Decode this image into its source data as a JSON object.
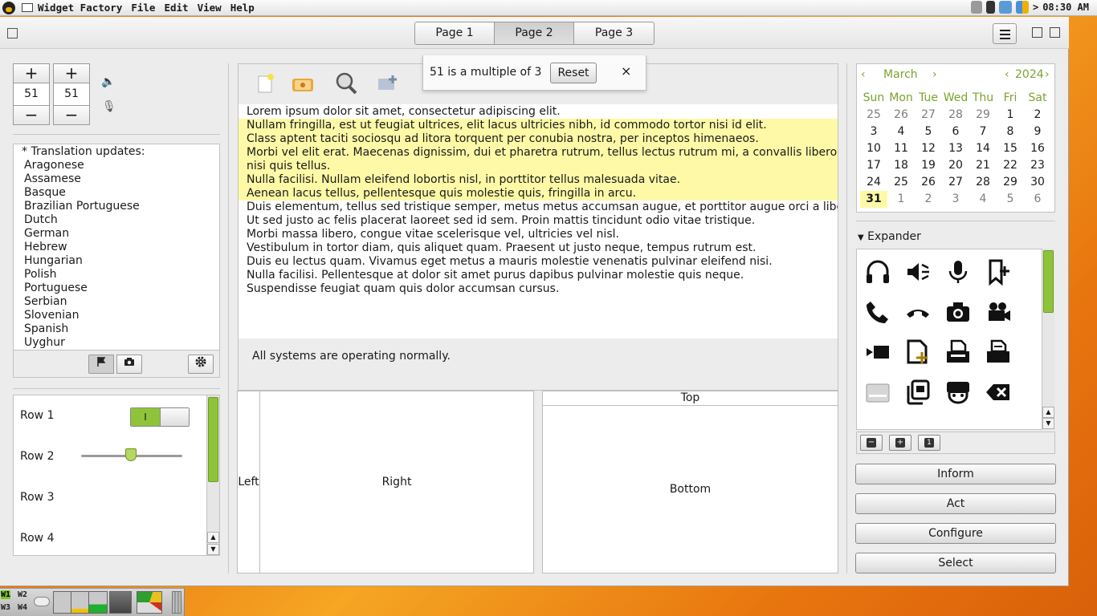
{
  "menubar": {
    "app_title": "Widget Factory",
    "menus": [
      "File",
      "Edit",
      "View",
      "Help"
    ],
    "clock": "08:30 AM",
    "tray_arrow": ">"
  },
  "tabs": [
    "Page 1",
    "Page 2",
    "Page 3"
  ],
  "active_tab": 1,
  "spinners": [
    {
      "value": "51",
      "plus": "+",
      "minus": "−"
    },
    {
      "value": "51",
      "plus": "+",
      "minus": "−"
    }
  ],
  "languages": {
    "header": "* Translation updates:",
    "items": [
      "Aragonese",
      "Assamese",
      "Basque",
      "Brazilian Portuguese",
      "Dutch",
      "German",
      "Hebrew",
      "Hungarian",
      "Polish",
      "Portuguese",
      "Serbian",
      "Slovenian",
      "Spanish",
      "Uyghur"
    ]
  },
  "rows": {
    "labels": [
      "Row 1",
      "Row 2",
      "Row 3",
      "Row 4"
    ],
    "switch_on_label": "I",
    "switch_state": true,
    "slider_value": 0.49
  },
  "notification": {
    "message": "51 is a multiple of 3",
    "reset_label": "Reset",
    "close_glyph": "×"
  },
  "editor": {
    "lines": [
      {
        "text": "Lorem ipsum dolor sit amet, consectetur adipiscing elit.",
        "hl": false
      },
      {
        "text": "Nullam fringilla, est ut feugiat ultrices, elit lacus ultricies nibh, id commodo tortor nisi id elit.",
        "hl": true
      },
      {
        "text": "Class aptent taciti sociosqu ad litora torquent per conubia nostra, per inceptos himenaeos.",
        "hl": true
      },
      {
        "text": "Morbi vel elit erat. Maecenas dignissim, dui et pharetra rutrum, tellus lectus rutrum mi, a convallis libero nisi quis tellus.",
        "hl": true
      },
      {
        "text": "Nulla facilisi. Nullam eleifend lobortis nisl, in porttitor tellus malesuada vitae.",
        "hl": true
      },
      {
        "text": "Aenean lacus tellus, pellentesque quis molestie quis, fringilla in arcu.",
        "hl": true
      },
      {
        "text": "Duis elementum, tellus sed tristique semper, metus metus accumsan augue, et porttitor augue orci a libero.",
        "hl": false
      },
      {
        "text": "Ut sed justo ac felis placerat laoreet sed id sem. Proin mattis tincidunt odio vitae tristique.",
        "hl": false
      },
      {
        "text": "Morbi massa libero, congue vitae scelerisque vel, ultricies vel nisl.",
        "hl": false
      },
      {
        "text": "Vestibulum in tortor diam, quis aliquet quam. Praesent ut justo neque, tempus rutrum est.",
        "hl": false
      },
      {
        "text": "Duis eu lectus quam. Vivamus eget metus a mauris molestie venenatis pulvinar eleifend nisi.",
        "hl": false
      },
      {
        "text": "Nulla facilisi. Pellentesque at dolor sit amet purus dapibus pulvinar molestie quis neque.",
        "hl": false
      },
      {
        "text": "Suspendisse feugiat quam quis dolor accumsan cursus.",
        "hl": false
      }
    ],
    "status": "All systems are operating normally."
  },
  "panes": {
    "left": "Left",
    "right": "Right",
    "top": "Top",
    "bottom": "Bottom"
  },
  "calendar": {
    "prev": "‹",
    "next": "›",
    "month": "March",
    "year": "2024",
    "day_names": [
      "Sun",
      "Mon",
      "Tue",
      "Wed",
      "Thu",
      "Fri",
      "Sat"
    ],
    "days": [
      [
        "25",
        "26",
        "27",
        "28",
        "29",
        "1",
        "2"
      ],
      [
        "3",
        "4",
        "5",
        "6",
        "7",
        "8",
        "9"
      ],
      [
        "10",
        "11",
        "12",
        "13",
        "14",
        "15",
        "16"
      ],
      [
        "17",
        "18",
        "19",
        "20",
        "21",
        "22",
        "23"
      ],
      [
        "24",
        "25",
        "26",
        "27",
        "28",
        "29",
        "30"
      ],
      [
        "31",
        "1",
        "2",
        "3",
        "4",
        "5",
        "6"
      ]
    ],
    "selected": "31"
  },
  "expander": {
    "label": "Expander",
    "icons": [
      "headphones-icon",
      "speaker-muted-icon",
      "microphone-icon",
      "bookmark-add-icon",
      "phone-icon",
      "hangup-icon",
      "camera-icon",
      "video-camera-icon",
      "video-record-icon",
      "document-new-icon",
      "printer-icon",
      "printer-alt-icon",
      "scanner-icon",
      "copy-icon",
      "face-icon",
      "backspace-icon"
    ],
    "tools": [
      "−",
      "+",
      "1"
    ]
  },
  "actions": [
    "Inform",
    "Act",
    "Configure",
    "Select"
  ],
  "taskbar": {
    "workspaces": [
      "W1",
      "W2",
      "W3",
      "W4"
    ],
    "current_workspace": "W1"
  },
  "colors": {
    "accent_green": "#8fc43a",
    "highlight_yellow": "#fdf9a6",
    "calendar_header": "#7aa32d"
  }
}
